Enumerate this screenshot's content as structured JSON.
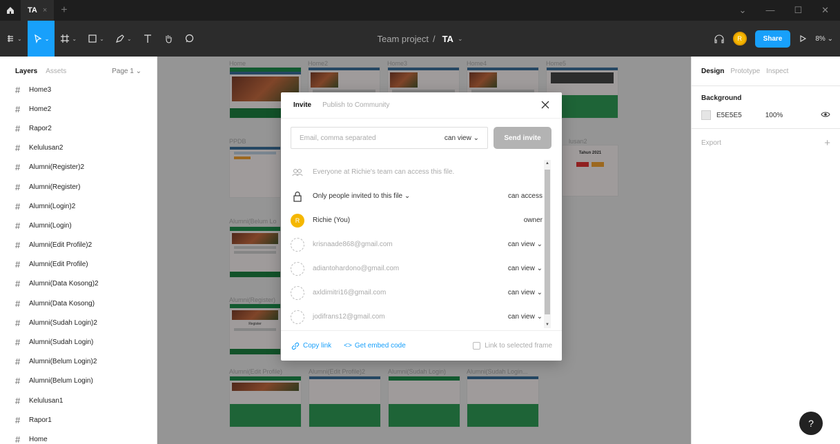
{
  "titlebar": {
    "tab_label": "TA",
    "tab_close": "×",
    "new_tab": "+"
  },
  "toolbar": {
    "project": "Team project",
    "separator": "/",
    "file_name": "TA",
    "share_label": "Share",
    "avatar_initial": "R",
    "zoom": "8%"
  },
  "left_panel": {
    "tab_layers": "Layers",
    "tab_assets": "Assets",
    "page": "Page 1",
    "layers": [
      "Home3",
      "Home2",
      "Rapor2",
      "Kelulusan2",
      "Alumni(Register)2",
      "Alumni(Register)",
      "Alumni(Login)2",
      "Alumni(Login)",
      "Alumni(Edit Profile)2",
      "Alumni(Edit Profile)",
      "Alumni(Data Kosong)2",
      "Alumni(Data Kosong)",
      "Alumni(Sudah Login)2",
      "Alumni(Sudah Login)",
      "Alumni(Belum Login)2",
      "Alumni(Belum Login)",
      "Kelulusan1",
      "Rapor1",
      "Home"
    ]
  },
  "canvas": {
    "frames": [
      "Home",
      "Home2",
      "Home3",
      "Home4",
      "Home5",
      "PPDB",
      "lusan2",
      "Alumni(Belum Lo",
      "Alumni(Register)",
      "Alumni(Edit Profile)",
      "Alumni(Edit Profile)2",
      "Alumni(Sudah Login)",
      "Alumni(Sudah Login..."
    ],
    "thumb_text": [
      "Tahun 2021",
      "Register"
    ]
  },
  "right_panel": {
    "tab_design": "Design",
    "tab_prototype": "Prototype",
    "tab_inspect": "Inspect",
    "background_title": "Background",
    "bg_hex": "E5E5E5",
    "bg_opacity": "100%",
    "export_label": "Export",
    "export_plus": "+"
  },
  "help": "?",
  "modal": {
    "tab_invite": "Invite",
    "tab_publish": "Publish to Community",
    "email_placeholder": "Email, comma separated",
    "invite_perm": "can view",
    "send_label": "Send invite",
    "team_access": "Everyone at Richie's team can access this file.",
    "only_invited": "Only people invited to this file",
    "can_access": "can access",
    "owner_name": "Richie (You)",
    "owner_initial": "R",
    "owner_role": "owner",
    "invitees": [
      {
        "email": "krisnaade868@gmail.com",
        "role": "can view"
      },
      {
        "email": "adiantohardono@gmail.com",
        "role": "can view"
      },
      {
        "email": "axldimitri16@gmail.com",
        "role": "can view"
      },
      {
        "email": "jodifrans12@gmail.com",
        "role": "can view"
      }
    ],
    "copy_link": "Copy link",
    "embed_icon": "<>",
    "embed_code": "Get embed code",
    "link_selected": "Link to selected frame"
  }
}
